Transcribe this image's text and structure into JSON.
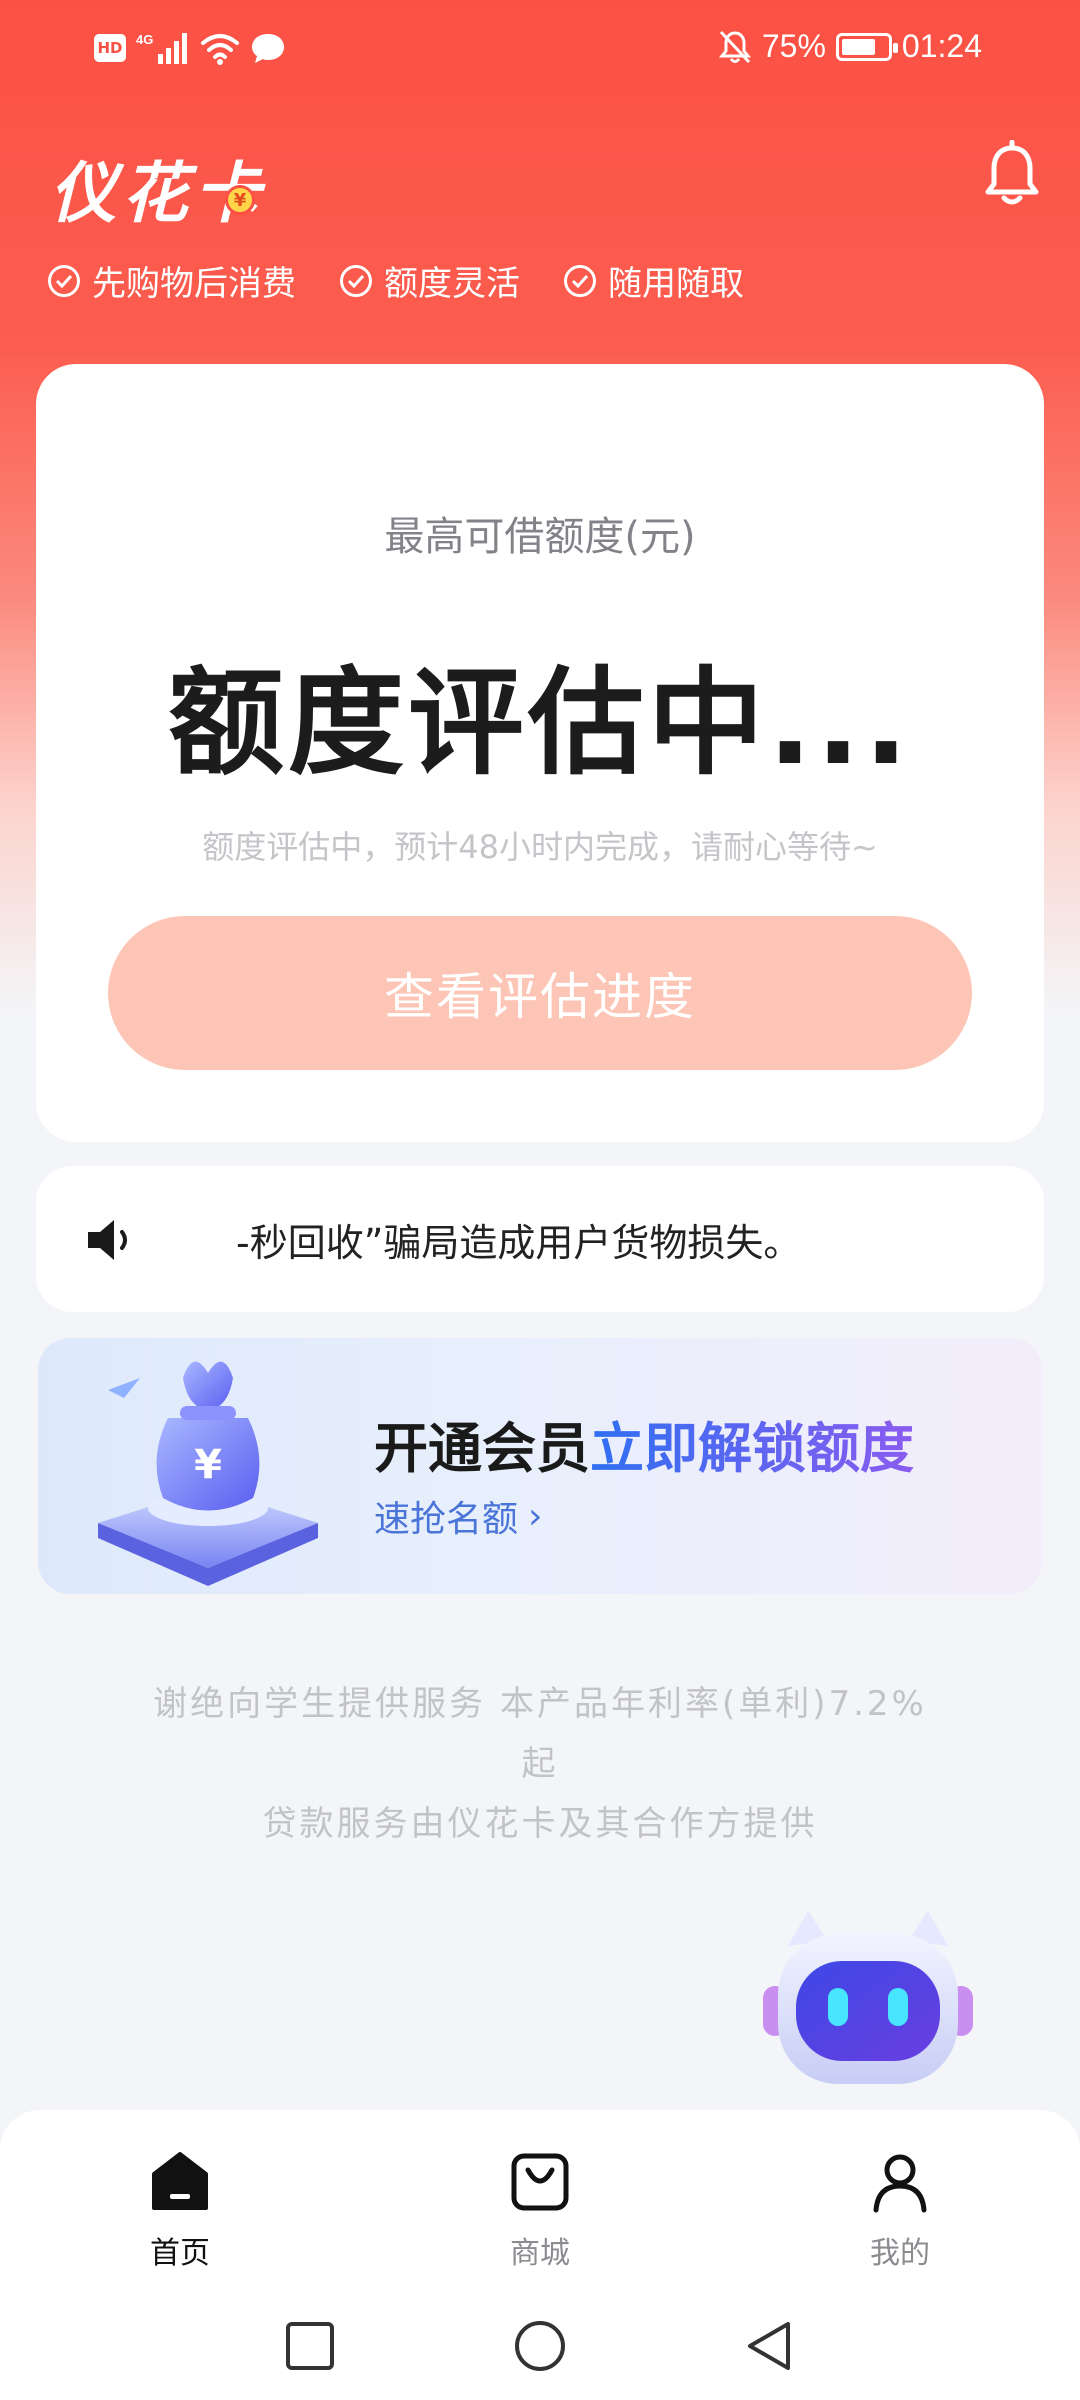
{
  "status_bar": {
    "left_icons": [
      "hd-icon",
      "signal-4g-icon",
      "wifi-icon",
      "message-icon"
    ],
    "hd": "HD",
    "net": "4G",
    "battery_percent": "75%",
    "battery_level": 0.75,
    "time": "01:24"
  },
  "header": {
    "brand": "仪花卡",
    "features": [
      "先购物后消费",
      "额度灵活",
      "随用随取"
    ]
  },
  "credit_card": {
    "label": "最高可借额度(元)",
    "status": "额度评估中...",
    "hint": "额度评估中，预计48小时内完成，请耐心等待~",
    "button": "查看评估进度"
  },
  "notice": {
    "text": "-秒回收”骗局造成用户货物损失。"
  },
  "vip_banner": {
    "title_plain": "开通会员",
    "title_highlight": "立即解锁额度",
    "subtitle": "速抢名额",
    "arrow": "›"
  },
  "disclaimer": {
    "line1": "谢绝向学生提供服务 本产品年利率(单利)7.2%",
    "line2": "起",
    "line3": "贷款服务由仪花卡及其合作方提供"
  },
  "tabs": [
    {
      "label": "首页",
      "icon": "home-icon",
      "active": true
    },
    {
      "label": "商城",
      "icon": "shopping-bag-icon",
      "active": false
    },
    {
      "label": "我的",
      "icon": "profile-icon",
      "active": false
    }
  ],
  "colors": {
    "brand_red": "#fb5144",
    "button_disabled": "#fdc5b5",
    "highlight_blue": "#2f6ff2"
  }
}
